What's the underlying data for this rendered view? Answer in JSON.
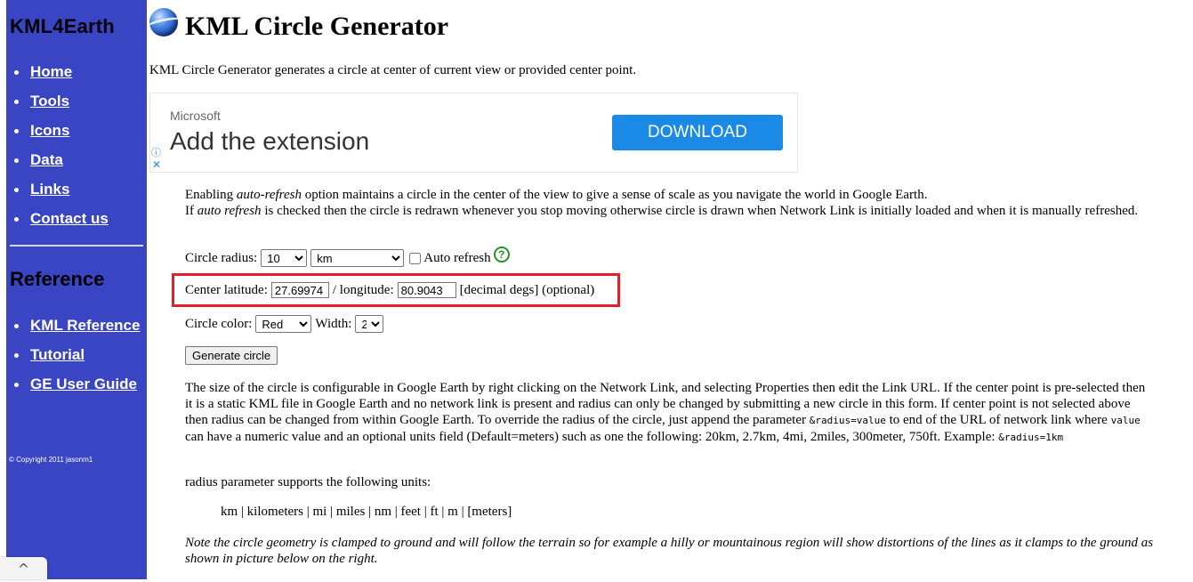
{
  "sidebar": {
    "brand": "KML4Earth",
    "nav": [
      {
        "label": "Home"
      },
      {
        "label": "Tools"
      },
      {
        "label": "Icons"
      },
      {
        "label": "Data"
      },
      {
        "label": "Links"
      },
      {
        "label": "Contact us"
      }
    ],
    "reference_heading": "Reference",
    "reference_links": [
      {
        "label": "KML Reference"
      },
      {
        "label": "Tutorial"
      },
      {
        "label": "GE User Guide"
      }
    ],
    "copyright": "© Copyright 2011 jasonm1",
    "scroll_top_glyph": "^"
  },
  "header": {
    "title": "KML Circle Generator",
    "intro": "KML Circle Generator generates a circle at center of current view or provided center point."
  },
  "ad": {
    "brand": "Microsoft",
    "headline": "Add the extension",
    "button": "DOWNLOAD",
    "info_glyph": "ⓘ",
    "close_glyph": "✕"
  },
  "autorefresh_paragraph": {
    "p1_a": "Enabling ",
    "p1_em": "auto-refresh",
    "p1_b": " option maintains a circle in the center of the view to give a sense of scale as you navigate the world in Google Earth.",
    "p2_a": "If ",
    "p2_em": "auto refresh",
    "p2_b": " is checked then the circle is redrawn whenever you stop moving otherwise circle is drawn when Network Link is initially loaded and when it is manually refreshed."
  },
  "form": {
    "radius_label": "Circle radius:",
    "radius_value": "10",
    "units_value": "km",
    "auto_refresh_label": "Auto refresh",
    "help_glyph": "?",
    "center_latitude_label": "Center latitude:",
    "latitude_value": "27.69974",
    "longitude_label": "/ longitude:",
    "longitude_value": "80.9043",
    "center_hint": "[decimal degs] (optional)",
    "color_label": "Circle color:",
    "color_value": "Red",
    "width_label": "Width:",
    "width_value": "2",
    "generate_button": "Generate circle"
  },
  "config_paragraph": {
    "a": "The size of the circle is configurable in Google Earth by right clicking on the Network Link, and selecting Properties then edit the Link URL. If the center point is pre-selected then it is a static KML file in Google Earth and no network link is present and radius can only be changed by submitting a new circle in this form. If center point is not selected above then radius can be changed from within Google Earth. To override the radius of the circle, just append the parameter ",
    "code1": "&radius=value",
    "b": " to end of the URL of network link where ",
    "code2": "value",
    "c": " can have a numeric value and an optional units field (Default=meters) such as one the following: 20km, 2.7km, 4mi, 2miles, 300meter, 750ft. Example: ",
    "code3": "&radius=1km"
  },
  "units_intro": "radius parameter supports the following units:",
  "units_list": "km | kilometers | mi | miles | nm | feet | ft | m | [meters]",
  "note": "Note the circle geometry is clamped to ground and will follow the terrain so for example a hilly or mountainous region will show distortions of the lines as it clamps to the ground as shown in picture below on the right."
}
